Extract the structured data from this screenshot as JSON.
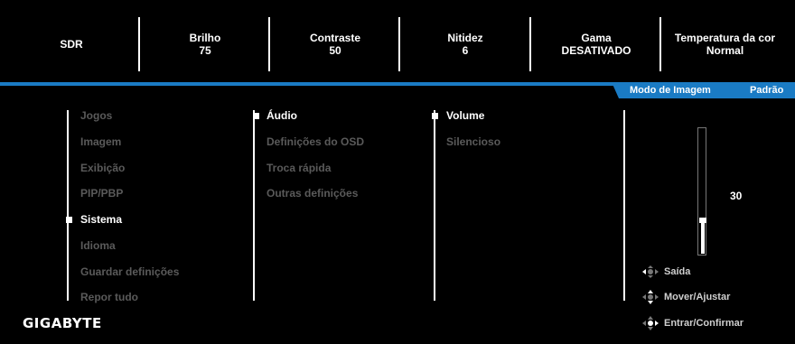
{
  "top_bar": [
    {
      "label": "SDR",
      "value": ""
    },
    {
      "label": "Brilho",
      "value": "75"
    },
    {
      "label": "Contraste",
      "value": "50"
    },
    {
      "label": "Nitidez",
      "value": "6"
    },
    {
      "label": "Gama",
      "value": "DESATIVADO"
    },
    {
      "label": "Temperatura da cor",
      "value": "Normal"
    }
  ],
  "mode": {
    "label": "Modo de Imagem",
    "value": "Padrão"
  },
  "main_menu": [
    {
      "label": "Jogos",
      "active": false
    },
    {
      "label": "Imagem",
      "active": false
    },
    {
      "label": "Exibição",
      "active": false
    },
    {
      "label": "PIP/PBP",
      "active": false
    },
    {
      "label": "Sistema",
      "active": true
    },
    {
      "label": "Idioma",
      "active": false
    },
    {
      "label": "Guardar definições",
      "active": false
    },
    {
      "label": "Repor tudo",
      "active": false
    }
  ],
  "sub_menu": [
    {
      "label": "Áudio",
      "active": true
    },
    {
      "label": "Definições do OSD",
      "active": false
    },
    {
      "label": "Troca rápida",
      "active": false
    },
    {
      "label": "Outras definições",
      "active": false
    }
  ],
  "sub_sub_menu": [
    {
      "label": "Volume",
      "active": true
    },
    {
      "label": "Silencioso",
      "active": false
    }
  ],
  "slider": {
    "value": "30",
    "level": 0.27
  },
  "hints": [
    {
      "icon": "joystick-left-icon",
      "label": "Saída"
    },
    {
      "icon": "joystick-updown-icon",
      "label": "Mover/Ajustar"
    },
    {
      "icon": "joystick-press-icon",
      "label": "Entrar/Confirmar"
    }
  ],
  "brand": "GIGABYTE",
  "colors": {
    "accent": "#1a7bc4",
    "inactive_text": "#5a5a5a",
    "background": "#000000"
  }
}
